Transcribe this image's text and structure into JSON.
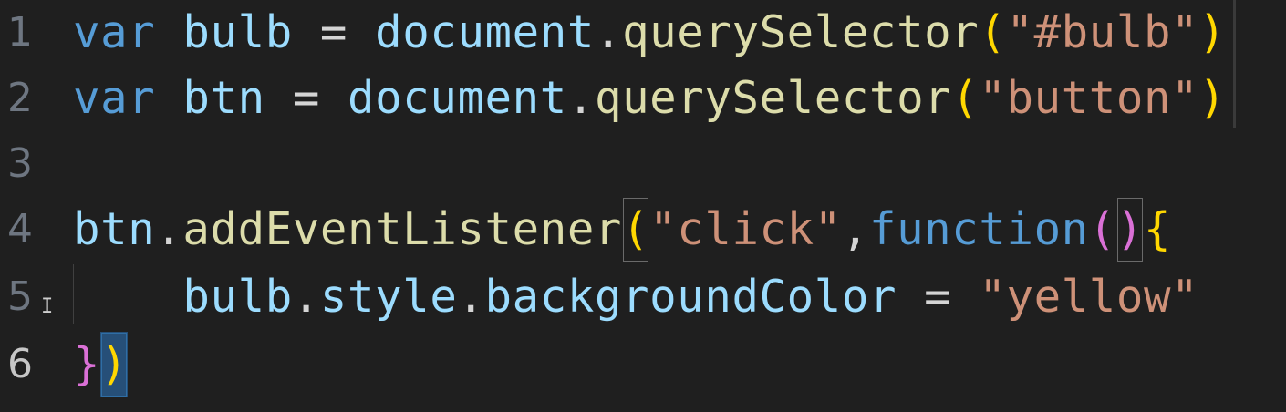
{
  "editor": {
    "colors": {
      "background": "#1f1f1f",
      "keyword": "#569cd6",
      "variable": "#9cdcfe",
      "function": "#dcdcaa",
      "string": "#ce9178",
      "operator": "#d4d4d4",
      "bracket_level1": "#ffd700",
      "bracket_level2": "#da70d6",
      "line_number": "#6e7681"
    },
    "lines": [
      {
        "number": "1",
        "tokens": [
          {
            "t": "var",
            "c": "kw"
          },
          {
            "t": " ",
            "c": "op"
          },
          {
            "t": "bulb",
            "c": "var"
          },
          {
            "t": " = ",
            "c": "op"
          },
          {
            "t": "document",
            "c": "var"
          },
          {
            "t": ".",
            "c": "op"
          },
          {
            "t": "querySelector",
            "c": "fn"
          },
          {
            "t": "(",
            "c": "p1"
          },
          {
            "t": "\"#bulb\"",
            "c": "str"
          },
          {
            "t": ")",
            "c": "p1"
          }
        ]
      },
      {
        "number": "2",
        "tokens": [
          {
            "t": "var",
            "c": "kw"
          },
          {
            "t": " ",
            "c": "op"
          },
          {
            "t": "btn",
            "c": "var"
          },
          {
            "t": " = ",
            "c": "op"
          },
          {
            "t": "document",
            "c": "var"
          },
          {
            "t": ".",
            "c": "op"
          },
          {
            "t": "querySelector",
            "c": "fn"
          },
          {
            "t": "(",
            "c": "p1"
          },
          {
            "t": "\"button\"",
            "c": "str"
          },
          {
            "t": ")",
            "c": "p1"
          }
        ]
      },
      {
        "number": "3",
        "tokens": []
      },
      {
        "number": "4",
        "tokens": [
          {
            "t": "btn",
            "c": "var"
          },
          {
            "t": ".",
            "c": "op"
          },
          {
            "t": "addEventListener",
            "c": "fn"
          },
          {
            "t": "(",
            "c": "p1",
            "m": "match"
          },
          {
            "t": "\"click\"",
            "c": "str"
          },
          {
            "t": ",",
            "c": "op"
          },
          {
            "t": "function",
            "c": "kw"
          },
          {
            "t": "(",
            "c": "p2"
          },
          {
            "t": ")",
            "c": "p2",
            "m": "match"
          },
          {
            "t": "{",
            "c": "p1"
          }
        ]
      },
      {
        "number": "5",
        "tokens": [
          {
            "t": "    ",
            "c": "op"
          },
          {
            "t": "bulb",
            "c": "var"
          },
          {
            "t": ".",
            "c": "op"
          },
          {
            "t": "style",
            "c": "var"
          },
          {
            "t": ".",
            "c": "op"
          },
          {
            "t": "backgroundColor",
            "c": "var"
          },
          {
            "t": " = ",
            "c": "op"
          },
          {
            "t": "\"yellow\"",
            "c": "str"
          }
        ]
      },
      {
        "number": "6",
        "active": true,
        "tokens": [
          {
            "t": "}",
            "c": "p2"
          },
          {
            "t": ")",
            "c": "p1",
            "m": "match-sel"
          }
        ]
      }
    ]
  }
}
